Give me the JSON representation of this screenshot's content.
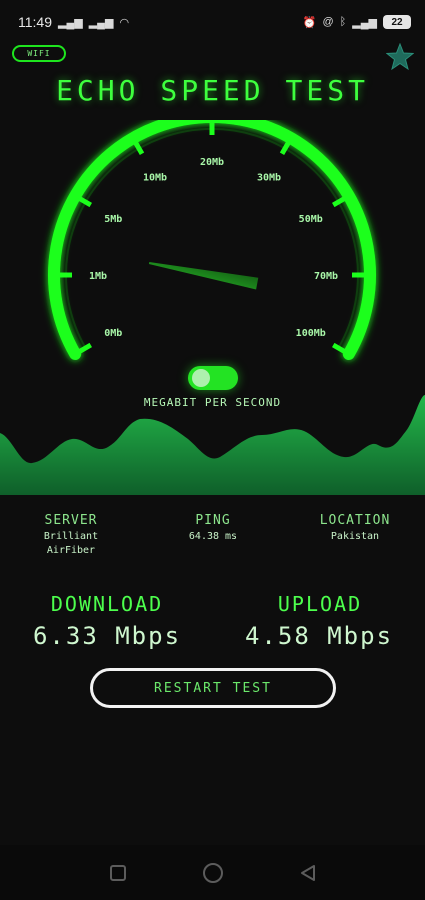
{
  "status_bar": {
    "time": "11:49",
    "battery": "22",
    "left_icons": [
      "signal-icon",
      "signal-icon",
      "wifi-icon"
    ],
    "right_icons": [
      "alarm-icon",
      "at-icon",
      "bluetooth-icon",
      "signal-icon"
    ]
  },
  "header": {
    "wifi_chip": "WIFI",
    "title": "ECHO SPEED TEST",
    "star_icon": "star-icon"
  },
  "gauge": {
    "ticks": [
      "0Mb",
      "1Mb",
      "5Mb",
      "10Mb",
      "20Mb",
      "30Mb",
      "50Mb",
      "70Mb",
      "100Mb"
    ],
    "needle_fraction": 0.17,
    "toggle_on": true,
    "unit_label": "MEGABIT PER SECOND"
  },
  "info": {
    "server": {
      "label": "SERVER",
      "value_line1": "Brilliant",
      "value_line2": "AirFiber"
    },
    "ping": {
      "label": "PING",
      "value": "64.38 ms"
    },
    "location": {
      "label": "LOCATION",
      "value": "Pakistan"
    }
  },
  "results": {
    "download_label": "DOWNLOAD",
    "download_value": "6.33 Mbps",
    "upload_label": "UPLOAD",
    "upload_value": "4.58 Mbps"
  },
  "actions": {
    "restart_label": "RESTART TEST"
  },
  "nav": {
    "icons": [
      "recent-apps-icon",
      "home-icon",
      "back-icon"
    ]
  },
  "colors": {
    "accent": "#1ee51e",
    "background": "#0d0d0d",
    "text": "#9ff59f"
  }
}
